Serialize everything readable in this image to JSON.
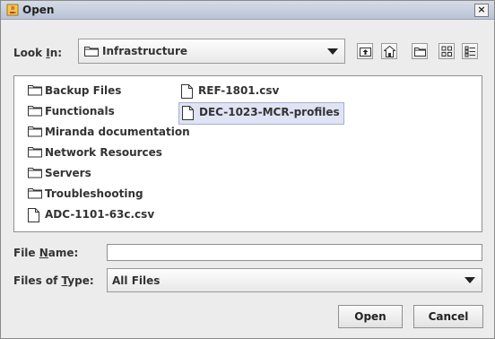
{
  "window": {
    "title": "Open",
    "close_glyph": "×"
  },
  "look_in": {
    "label_prefix": "Look ",
    "label_mnemonic": "I",
    "label_suffix": "n:",
    "value": "Infrastructure"
  },
  "toolbar": {
    "buttons": [
      {
        "icon": "up-one-level-icon"
      },
      {
        "icon": "home-icon"
      },
      {
        "icon": "new-folder-icon"
      },
      {
        "icon": "list-view-icon"
      },
      {
        "icon": "details-view-icon"
      }
    ]
  },
  "files": {
    "col1": [
      {
        "name": "Backup Files",
        "type": "folder"
      },
      {
        "name": "Functionals",
        "type": "folder"
      },
      {
        "name": "Miranda documentation",
        "type": "folder"
      },
      {
        "name": "Network Resources",
        "type": "folder"
      },
      {
        "name": "Servers",
        "type": "folder"
      },
      {
        "name": "Troubleshooting",
        "type": "folder"
      },
      {
        "name": "ADC-1101-63c.csv",
        "type": "file"
      }
    ],
    "col2": [
      {
        "name": "REF-1801.csv",
        "type": "file"
      },
      {
        "name": "DEC-1023-MCR-profiles",
        "type": "file",
        "selected": true
      }
    ]
  },
  "file_name": {
    "label_prefix": "File ",
    "label_mnemonic": "N",
    "label_suffix": "ame:",
    "value": ""
  },
  "file_type": {
    "label_prefix": "Files of ",
    "label_mnemonic": "T",
    "label_suffix": "ype:",
    "value": "All Files"
  },
  "buttons": {
    "open": "Open",
    "cancel": "Cancel"
  }
}
